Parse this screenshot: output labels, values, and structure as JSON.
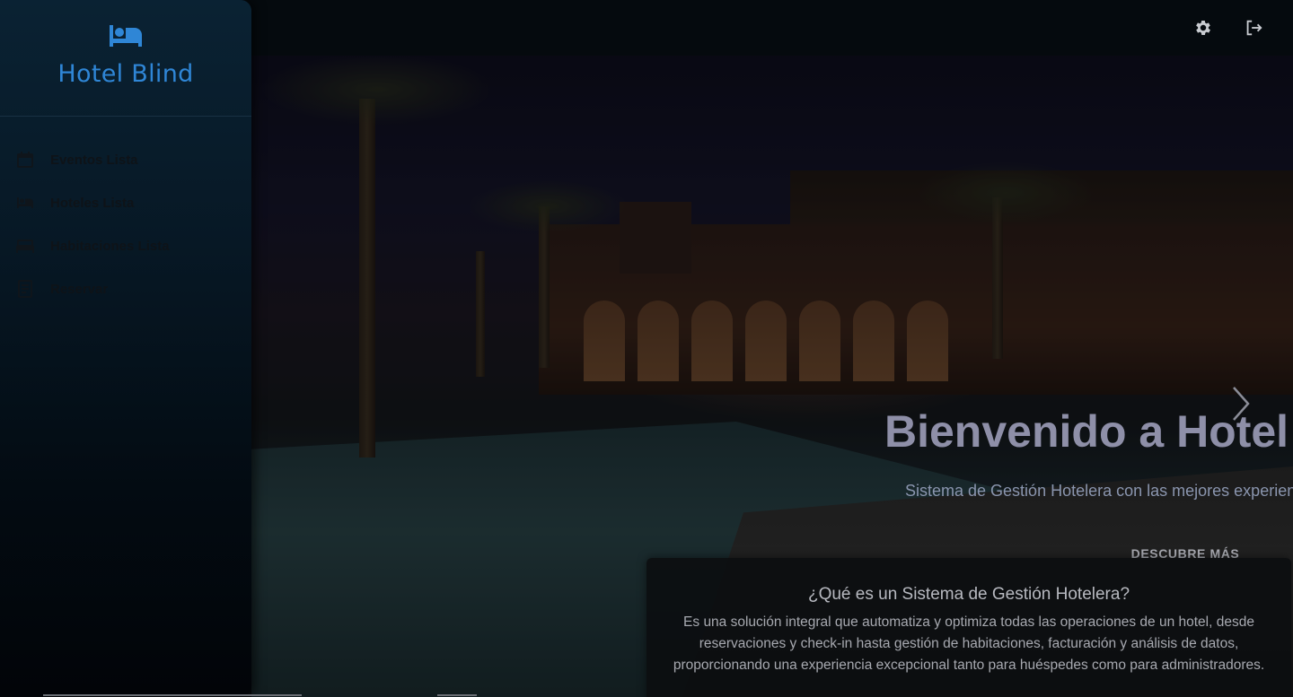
{
  "sidebar": {
    "brand": {
      "name": "Hotel Blind",
      "icon": "bed-icon",
      "color": "#2f86d6"
    },
    "items": [
      {
        "label": "Eventos Lista",
        "icon": "calendar-icon"
      },
      {
        "label": "Hoteles Lista",
        "icon": "bed-icon"
      },
      {
        "label": "Habitaciones Lista",
        "icon": "room-icon"
      },
      {
        "label": "Reservar",
        "icon": "booking-icon"
      }
    ]
  },
  "topbar": {
    "settings_icon": "gear-icon",
    "logout_icon": "logout-icon"
  },
  "hero": {
    "title": "Bienvenido a Hotel Blind",
    "subtitle": "Sistema de Gestión Hotelera con las mejores experiencias",
    "cta": "DESCUBRE MÁS",
    "next_icon": "chevron-right-icon"
  },
  "info_card": {
    "title": "¿Qué es un Sistema de Gestión Hotelera?",
    "text": "Es una solución integral que automatiza y optimiza todas las operaciones de un hotel, desde reservaciones y check-in hasta gestión de habitaciones, facturación y análisis de datos, proporcionando una experiencia excepcional tanto para huéspedes como para administradores."
  }
}
